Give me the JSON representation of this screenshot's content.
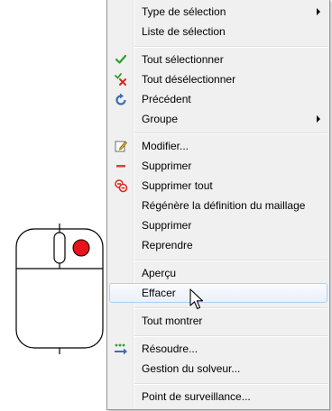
{
  "menu": {
    "items": [
      {
        "label": "Type de sélection",
        "icon": "none",
        "submenu": true
      },
      {
        "label": "Liste de sélection",
        "icon": "none",
        "submenu": false
      },
      {
        "label": "Tout sélectionner",
        "icon": "green-check-icon",
        "submenu": false
      },
      {
        "label": "Tout désélectionner",
        "icon": "cross-check-icon",
        "submenu": false
      },
      {
        "label": "Précédent",
        "icon": "undo-icon",
        "submenu": false
      },
      {
        "label": "Groupe",
        "icon": "none",
        "submenu": true
      },
      {
        "label": "Modifier...",
        "icon": "edit-icon",
        "submenu": false
      },
      {
        "label": "Supprimer",
        "icon": "minus-icon",
        "submenu": false
      },
      {
        "label": "Supprimer tout",
        "icon": "delete-all-icon",
        "submenu": false
      },
      {
        "label": "Régénère la définition du maillage",
        "icon": "none",
        "submenu": false
      },
      {
        "label": "Supprimer",
        "icon": "none",
        "submenu": false
      },
      {
        "label": "Reprendre",
        "icon": "none",
        "submenu": false
      },
      {
        "label": "Aperçu",
        "icon": "none",
        "submenu": false
      },
      {
        "label": "Effacer",
        "icon": "none",
        "submenu": false,
        "highlighted": true
      },
      {
        "label": "Tout montrer",
        "icon": "none",
        "submenu": false
      },
      {
        "label": "Résoudre...",
        "icon": "solve-icon",
        "submenu": false
      },
      {
        "label": "Gestion du solveur...",
        "icon": "none",
        "submenu": false
      },
      {
        "label": "Point de surveillance...",
        "icon": "none",
        "submenu": false
      }
    ]
  },
  "colors": {
    "menu_background": "#f0f0f0",
    "highlight_border": "#aecff7",
    "mouse_button_dot": "#e8141b"
  },
  "illustration": {
    "icon": "mouse-right-click-icon"
  }
}
